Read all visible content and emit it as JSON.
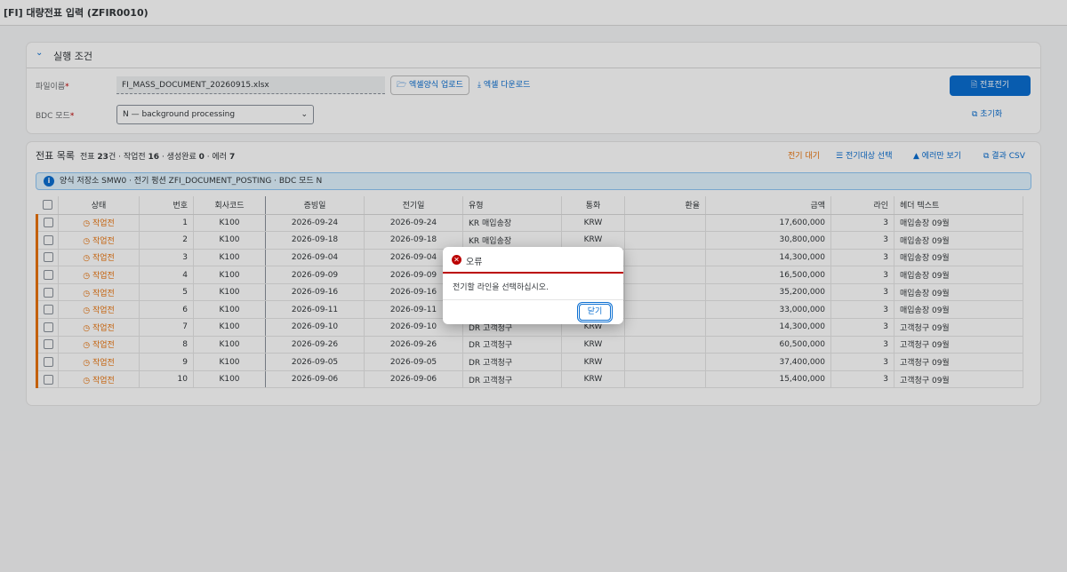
{
  "app": {
    "tag": "[FI]",
    "title": "대량전표 입력",
    "code": "(ZFIR0010)"
  },
  "criteria": {
    "section_title": "실행 조건",
    "file_label": "파일이름",
    "file_value": "FI_MASS_DOCUMENT_20260915.xlsx",
    "upload_label": "엑셀양식 업로드",
    "download_label": "엑셀 다운로드",
    "bdc_label": "BDC 모드",
    "bdc_value": "N — background processing",
    "post_label": "전표전기",
    "reset_label": "초기화",
    "required_mark": "*"
  },
  "list": {
    "title": "전표 목록",
    "summary_prefix": "전표",
    "total": "23",
    "total_unit": "건 · 작업전",
    "pending": "16",
    "done_label": "· 생성완료",
    "done": "0",
    "error_label": "· 에러",
    "errors": "7",
    "toolbar": {
      "waiting": "전기 대기",
      "select_target": "전기대상 선택",
      "errors_only": "에러만 보기",
      "export_csv": "결과 CSV"
    },
    "info": "양식 저장소 SMW0 · 전기 펑션 ZFI_DOCUMENT_POSTING · BDC 모드 N",
    "columns": [
      "상태",
      "번호",
      "회사코드",
      "증빙일",
      "전기일",
      "유형",
      "통화",
      "환율",
      "금액",
      "라인",
      "헤더 텍스트"
    ],
    "rows": [
      {
        "status": "작업전",
        "no": "1",
        "company": "K100",
        "doc_date": "2026-09-24",
        "post_date": "2026-09-24",
        "type": "KR 매입송장",
        "currency": "KRW",
        "rate": "",
        "amount": "17,600,000",
        "lines": "3",
        "header": "매입송장 09월"
      },
      {
        "status": "작업전",
        "no": "2",
        "company": "K100",
        "doc_date": "2026-09-18",
        "post_date": "2026-09-18",
        "type": "KR 매입송장",
        "currency": "KRW",
        "rate": "",
        "amount": "30,800,000",
        "lines": "3",
        "header": "매입송장 09월"
      },
      {
        "status": "작업전",
        "no": "3",
        "company": "K100",
        "doc_date": "2026-09-04",
        "post_date": "2026-09-04",
        "type": "",
        "currency": "",
        "rate": "",
        "amount": "14,300,000",
        "lines": "3",
        "header": "매입송장 09월"
      },
      {
        "status": "작업전",
        "no": "4",
        "company": "K100",
        "doc_date": "2026-09-09",
        "post_date": "2026-09-09",
        "type": "",
        "currency": "",
        "rate": "",
        "amount": "16,500,000",
        "lines": "3",
        "header": "매입송장 09월"
      },
      {
        "status": "작업전",
        "no": "5",
        "company": "K100",
        "doc_date": "2026-09-16",
        "post_date": "2026-09-16",
        "type": "",
        "currency": "",
        "rate": "",
        "amount": "35,200,000",
        "lines": "3",
        "header": "매입송장 09월"
      },
      {
        "status": "작업전",
        "no": "6",
        "company": "K100",
        "doc_date": "2026-09-11",
        "post_date": "2026-09-11",
        "type": "",
        "currency": "",
        "rate": "",
        "amount": "33,000,000",
        "lines": "3",
        "header": "매입송장 09월"
      },
      {
        "status": "작업전",
        "no": "7",
        "company": "K100",
        "doc_date": "2026-09-10",
        "post_date": "2026-09-10",
        "type": "DR 고객청구",
        "currency": "KRW",
        "rate": "",
        "amount": "14,300,000",
        "lines": "3",
        "header": "고객청구 09월"
      },
      {
        "status": "작업전",
        "no": "8",
        "company": "K100",
        "doc_date": "2026-09-26",
        "post_date": "2026-09-26",
        "type": "DR 고객청구",
        "currency": "KRW",
        "rate": "",
        "amount": "60,500,000",
        "lines": "3",
        "header": "고객청구 09월"
      },
      {
        "status": "작업전",
        "no": "9",
        "company": "K100",
        "doc_date": "2026-09-05",
        "post_date": "2026-09-05",
        "type": "DR 고객청구",
        "currency": "KRW",
        "rate": "",
        "amount": "37,400,000",
        "lines": "3",
        "header": "고객청구 09월"
      },
      {
        "status": "작업전",
        "no": "10",
        "company": "K100",
        "doc_date": "2026-09-06",
        "post_date": "2026-09-06",
        "type": "DR 고객청구",
        "currency": "KRW",
        "rate": "",
        "amount": "15,400,000",
        "lines": "3",
        "header": "고객청구 09월"
      }
    ]
  },
  "dialog": {
    "title": "오류",
    "message": "전기할 라인을 선택하십시오.",
    "close_label": "닫기"
  },
  "colors": {
    "accent": "#0a6ed1",
    "warning": "#e9730c",
    "error": "#bb0000"
  }
}
